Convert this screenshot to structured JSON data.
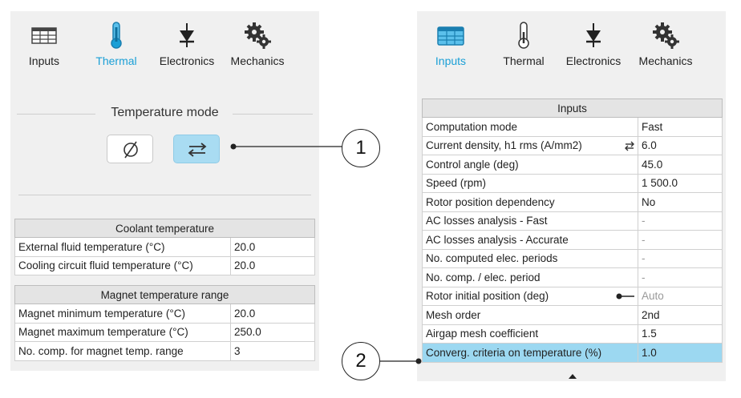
{
  "left": {
    "tabs": [
      {
        "label": "Inputs",
        "icon": "table-icon"
      },
      {
        "label": "Thermal",
        "icon": "thermometer-icon"
      },
      {
        "label": "Electronics",
        "icon": "diode-icon"
      },
      {
        "label": "Mechanics",
        "icon": "gears-icon"
      }
    ],
    "active_tab": "Thermal",
    "temperature_mode": {
      "title": "Temperature mode",
      "options": [
        {
          "symbol": "Ø",
          "icon": "empty-set-icon"
        },
        {
          "symbol": "⇄",
          "icon": "swap-arrows-icon"
        }
      ],
      "selected": 1
    },
    "coolant": {
      "title": "Coolant temperature",
      "rows": [
        {
          "label": "External fluid temperature (°C)",
          "value": "20.0"
        },
        {
          "label": "Cooling circuit fluid temperature (°C)",
          "value": "20.0"
        }
      ]
    },
    "magnet": {
      "title": "Magnet temperature range",
      "rows": [
        {
          "label": "Magnet minimum temperature (°C)",
          "value": "20.0"
        },
        {
          "label": "Magnet maximum temperature (°C)",
          "value": "250.0"
        },
        {
          "label": "No. comp. for magnet temp. range",
          "value": "3"
        }
      ]
    }
  },
  "right": {
    "tabs": [
      {
        "label": "Inputs",
        "icon": "table-icon"
      },
      {
        "label": "Thermal",
        "icon": "thermometer-icon"
      },
      {
        "label": "Electronics",
        "icon": "diode-icon"
      },
      {
        "label": "Mechanics",
        "icon": "gears-icon"
      }
    ],
    "active_tab": "Inputs",
    "inputs": {
      "title": "Inputs",
      "rows": [
        {
          "label": "Computation mode",
          "value": "Fast"
        },
        {
          "label": "Current density, h1 rms (A/mm2)",
          "value": "6.0",
          "icon": "swap-icon"
        },
        {
          "label": "Control angle (deg)",
          "value": "45.0"
        },
        {
          "label": "Speed (rpm)",
          "value": "1 500.0"
        },
        {
          "label": "Rotor position dependency",
          "value": "No"
        },
        {
          "label": "AC losses analysis - Fast",
          "value": "-"
        },
        {
          "label": "AC losses analysis - Accurate",
          "value": "-"
        },
        {
          "label": "No. computed elec. periods",
          "value": "-"
        },
        {
          "label": "No. comp. / elec. period",
          "value": "-"
        },
        {
          "label": "Rotor initial position (deg)",
          "value": "Auto",
          "icon": "pin-icon"
        },
        {
          "label": "Mesh order",
          "value": "2nd"
        },
        {
          "label": "Airgap mesh coefficient",
          "value": "1.5"
        },
        {
          "label": "Converg. criteria on temperature (%)",
          "value": "1.0"
        }
      ],
      "selected_row": 12
    }
  },
  "callouts": [
    "1",
    "2"
  ],
  "colors": {
    "accent": "#1a9fd6",
    "selected_row": "#9cd8f1",
    "panel": "#f0f0f0"
  }
}
